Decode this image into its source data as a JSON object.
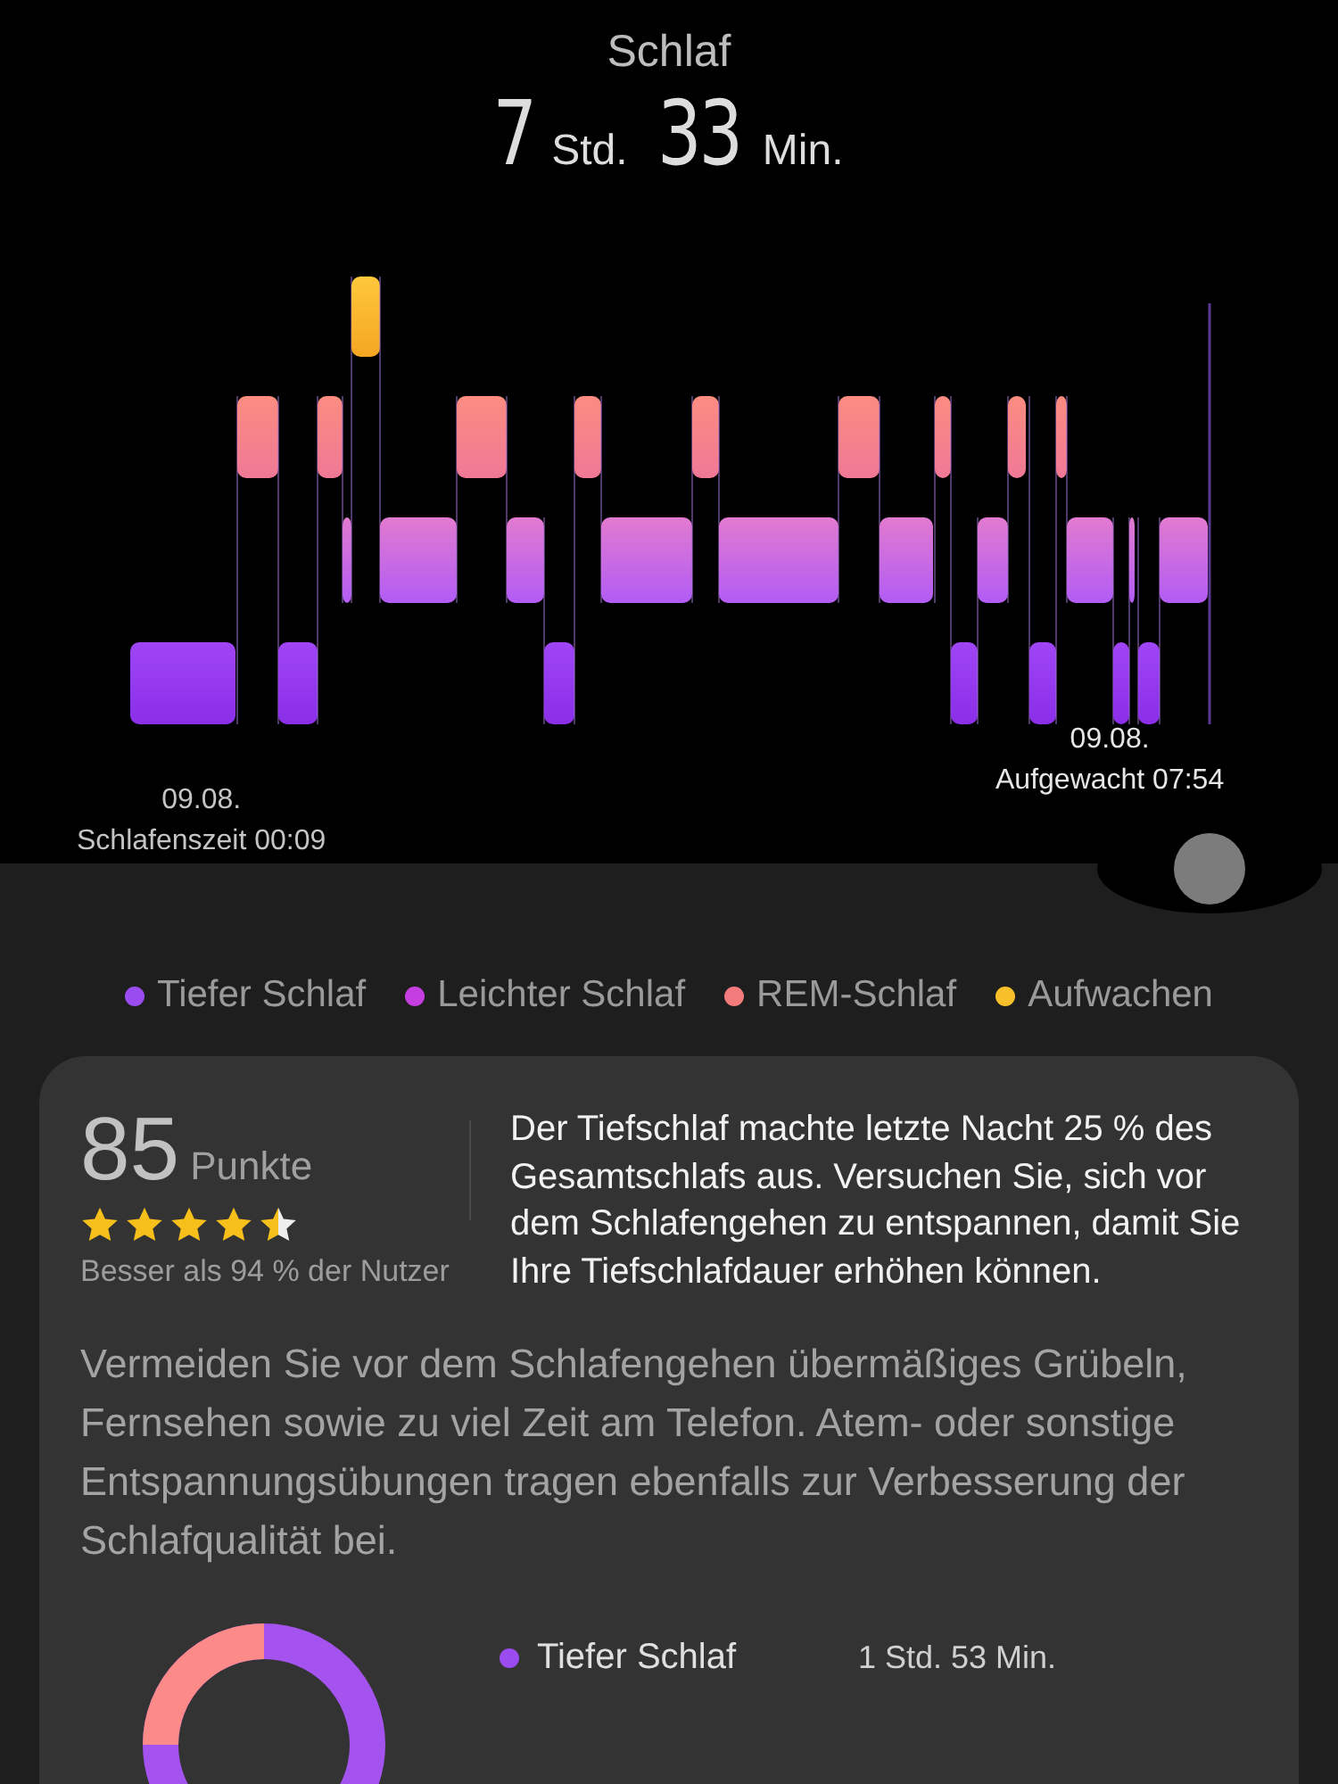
{
  "header": {
    "title": "Schlaf",
    "duration": [
      {
        "value": "7",
        "unit": "Std."
      },
      {
        "value": "33",
        "unit": "Min."
      }
    ]
  },
  "chart": {
    "start_date": "09.08.",
    "start_label": "Schlafenszeit 00:09",
    "end_date": "09.08.",
    "end_label": "Aufgewacht 07:54"
  },
  "legend": [
    {
      "label": "Tiefer Schlaf",
      "color": "#9b4cf0"
    },
    {
      "label": "Leichter Schlaf",
      "color": "#c43ee0"
    },
    {
      "label": "REM-Schlaf",
      "color": "#f27c7c"
    },
    {
      "label": "Aufwachen",
      "color": "#f7bf2a"
    }
  ],
  "score": {
    "value": "85",
    "unit": "Punkte",
    "stars": 4.5,
    "comparison": "Besser als 94 % der Nutzer"
  },
  "insight": "Der Tiefschlaf machte letzte Nacht 25 % des Gesamtschlafs aus. Versuchen Sie, sich vor dem Schlafengehen zu entspannen, damit Sie Ihre Tiefschlafdauer erhöhen können.",
  "advice": "Vermeiden Sie vor dem Schlafengehen übermäßiges Grübeln, Fernsehen sowie zu viel Zeit am Telefon. Atem- oder sonstige Entspannungsübungen tragen ebenfalls zur Verbesserung der Schlafqualität bei.",
  "stages": [
    {
      "label": "Tiefer Schlaf",
      "duration": "1 Std. 53 Min.",
      "color": "#9b4cf0"
    }
  ]
}
